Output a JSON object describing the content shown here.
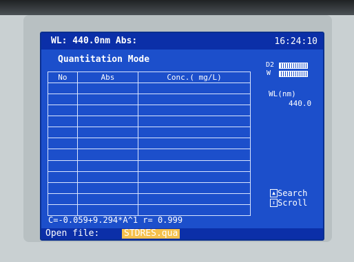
{
  "header": {
    "wl_readout": "WL: 440.0nm Abs:",
    "time": "16:24:10"
  },
  "mode_title": "Quantitation Mode",
  "table": {
    "columns": [
      "No",
      "Abs",
      "Conc.( mg/L)"
    ],
    "rows": [
      [
        "",
        "",
        ""
      ],
      [
        "",
        "",
        ""
      ],
      [
        "",
        "",
        ""
      ],
      [
        "",
        "",
        ""
      ],
      [
        "",
        "",
        ""
      ],
      [
        "",
        "",
        ""
      ],
      [
        "",
        "",
        ""
      ],
      [
        "",
        "",
        ""
      ],
      [
        "",
        "",
        ""
      ],
      [
        "",
        "",
        ""
      ],
      [
        "",
        "",
        ""
      ],
      [
        "",
        "",
        ""
      ]
    ]
  },
  "lamps": {
    "d2": "D2",
    "w": "W"
  },
  "wavelength": {
    "label": "WL(nm)",
    "value": "440.0"
  },
  "keys": {
    "search": "Search",
    "scroll": "Scroll"
  },
  "equation": "C=-0.059+9.294*A^1  r= 0.999",
  "status": {
    "label": "Open file:",
    "filename": "STDRES.qua"
  },
  "colors": {
    "screen": "#1c4fcb",
    "header": "#0b2fa8",
    "highlight": "#f6c04c"
  }
}
